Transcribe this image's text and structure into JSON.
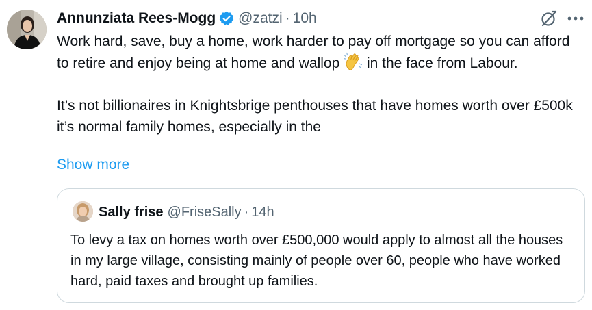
{
  "author": {
    "name": "Annunziata Rees-Mogg",
    "handle": "@zatzi",
    "separator": "·",
    "time": "10h",
    "verified": true,
    "verified_color": "#1d9bf0"
  },
  "tweet": {
    "line1_before_emoji": "Work hard, save, buy a home, work harder to pay off mortgage so you can afford to retire and enjoy being at home and wallop ",
    "emoji": "clapping-hands-emoji",
    "line1_after_emoji": " in the face from Labour.",
    "paragraph2": "It’s not billionaires in Knightsbrige penthouses that have homes worth over £500k it’s normal family homes, especially in the",
    "show_more": "Show more",
    "link_color": "#1d9bf0"
  },
  "actions": {
    "grok_icon": "grok-icon",
    "more_icon": "more-icon"
  },
  "quote": {
    "name": "Sally frise",
    "handle": "@FriseSally",
    "separator": "·",
    "time": "14h",
    "text": "To levy a tax on homes worth over £500,000 would apply to almost all the houses in my large village, consisting mainly of people over 60, people who have worked hard, paid taxes and brought up families."
  }
}
